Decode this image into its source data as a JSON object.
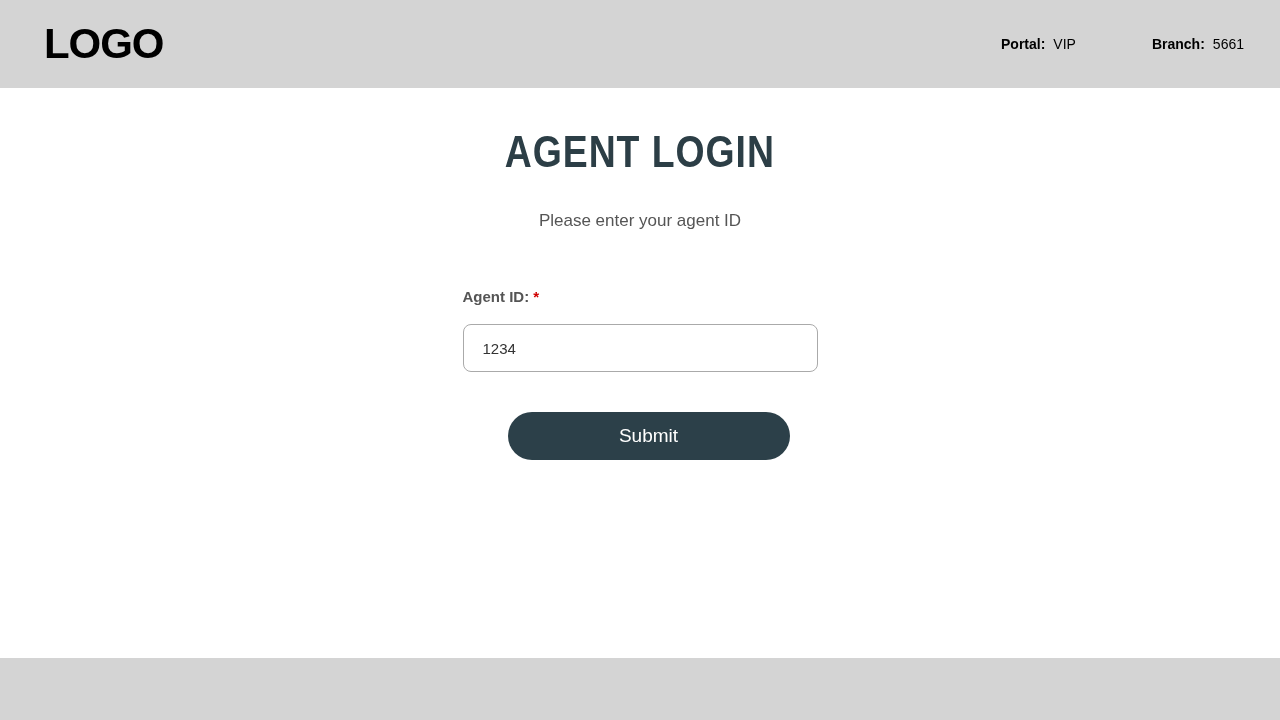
{
  "header": {
    "logo": "LOGO",
    "info": [
      {
        "label": "Portal:",
        "value": "VIP"
      },
      {
        "label": "Branch:",
        "value": "5661"
      }
    ]
  },
  "title": "AGENT LOGIN",
  "subtitle": "Please enter your agent ID",
  "field": {
    "label": "Agent ID:",
    "required_mark": "*",
    "value": "1234"
  },
  "submit": "Submit"
}
